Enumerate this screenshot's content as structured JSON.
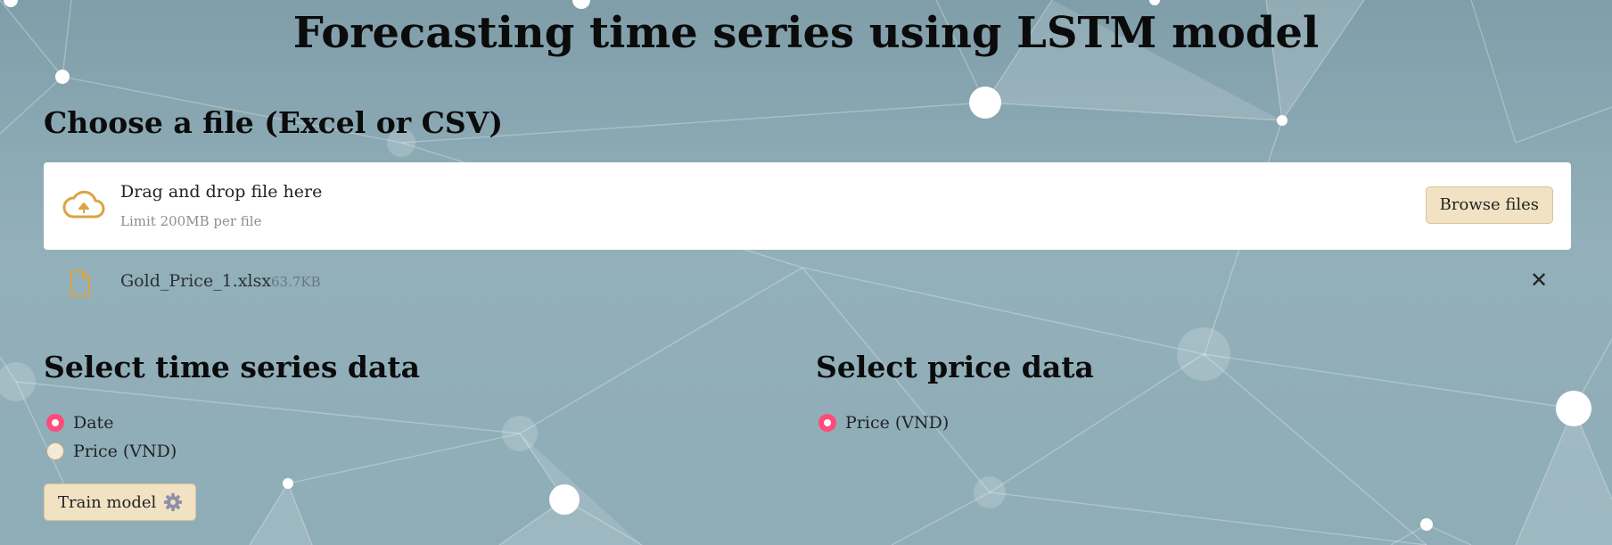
{
  "page": {
    "title": "Forecasting time series using LSTM model"
  },
  "upload": {
    "heading": "Choose a file (Excel or CSV)",
    "dropzone_title": "Drag and drop file here",
    "dropzone_limit": "Limit 200MB per file",
    "browse_label": "Browse files",
    "icon": "cloud-upload-icon"
  },
  "uploaded_file": {
    "name": "Gold_Price_1.xlsx",
    "size": "63.7KB",
    "icon": "file-icon",
    "remove_icon": "close-icon",
    "remove_glyph": "✕"
  },
  "time_series": {
    "heading": "Select time series data",
    "options": [
      {
        "label": "Date",
        "selected": true
      },
      {
        "label": "Price (VND)",
        "selected": false
      }
    ]
  },
  "price": {
    "heading": "Select price data",
    "options": [
      {
        "label": "Price (VND)",
        "selected": true
      }
    ]
  },
  "train": {
    "label": "Train model",
    "icon": "gear-icon"
  },
  "colors": {
    "accent_radio": "#ff4b7b",
    "button_bg": "#f2e2c4",
    "upload_icon": "#d9a443",
    "background": "#8fadb7"
  }
}
